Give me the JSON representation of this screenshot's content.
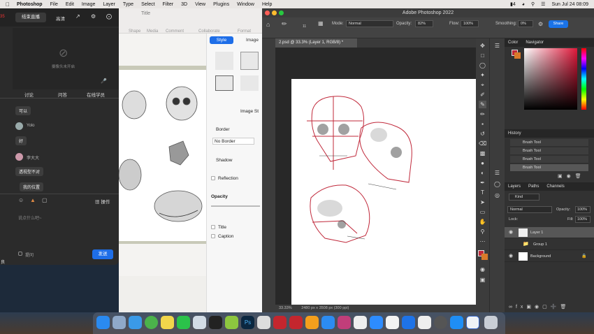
{
  "menubar": {
    "app": "Photoshop",
    "items": [
      "File",
      "Edit",
      "Image",
      "Layer",
      "Type",
      "Select",
      "Filter",
      "3D",
      "View",
      "Plugins",
      "Window",
      "Help"
    ],
    "battery": "4",
    "clock": "Sun Jul 24  08:09"
  },
  "live": {
    "end_label": "结束直播",
    "quality": "高清",
    "camera_off": "摄像头未开启",
    "timer": "35",
    "tabs": [
      "讨论",
      "问答",
      "在线学员"
    ],
    "messages": [
      {
        "text": "可以"
      },
      {
        "name": "Yolo"
      },
      {
        "text": "好"
      },
      {
        "name": "李大大"
      },
      {
        "text": "透视型不对"
      },
      {
        "text": "我的位置"
      }
    ],
    "ops_label": "操作",
    "placeholder": "说点什么吧~",
    "remind": "提问",
    "send": "发送",
    "side_char": "良"
  },
  "keynote": {
    "title": "Title",
    "tools": [
      "Shape",
      "Media",
      "Comment",
      "Collaborate",
      "Format"
    ],
    "tabs": [
      "Style",
      "Image"
    ],
    "image_styles": "Image St",
    "border": "Border",
    "no_border": "No Border",
    "shadow": "Shadow",
    "reflection": "Reflection",
    "opacity": "Opacity",
    "caption": "Caption"
  },
  "ps": {
    "window_title": "Adobe Photoshop 2022",
    "doc_tab": "2.psd @ 33.3% (Layer 1, RGB/8) *",
    "mode_label": "Mode:",
    "mode": "Normal",
    "opacity_label": "Opacity:",
    "opacity": "82%",
    "flow_label": "Flow:",
    "flow": "100%",
    "smoothing_label": "Smoothing:",
    "smoothing": "0%",
    "brush_size": "11",
    "share": "Share",
    "zoom": "33.33%",
    "doc_size": "2480 px x 3508 px (300 ppi)",
    "color_tabs": [
      "Color",
      "Navigator"
    ],
    "history_tab": "History",
    "history": [
      "Brush Tool",
      "Brush Tool",
      "Brush Tool",
      "Brush Tool"
    ],
    "layers_tabs": [
      "Layers",
      "Paths",
      "Channels"
    ],
    "kind": "Kind",
    "blend": "Normal",
    "layer_opacity_label": "Opacity:",
    "layer_opacity": "100%",
    "lock_label": "Lock:",
    "fill_label": "Fill:",
    "fill": "100%",
    "layers": [
      "Layer 1",
      "Group 1",
      "Background"
    ]
  },
  "colors": {
    "accent": "#1e6ee8",
    "ps_bg": "#535353",
    "sketch_red": "#c0283a"
  }
}
